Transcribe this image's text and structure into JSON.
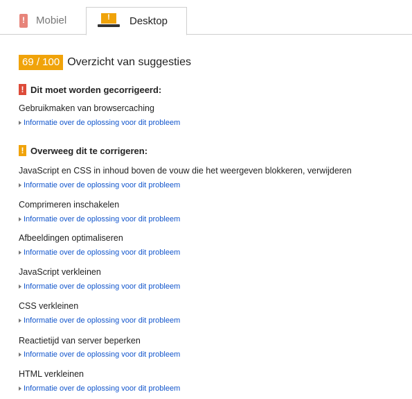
{
  "tabs": {
    "mobile": "Mobiel",
    "desktop": "Desktop"
  },
  "score": {
    "value": "69 / 100",
    "title": "Overzicht van suggesties"
  },
  "must_fix": {
    "heading": "Dit moet worden gecorrigeerd:",
    "items": [
      {
        "label": "Gebruikmaken van browsercaching",
        "link": "Informatie over de oplossing voor dit probleem"
      }
    ]
  },
  "consider_fix": {
    "heading": "Overweeg dit te corrigeren:",
    "items": [
      {
        "label": "JavaScript en CSS in inhoud boven de vouw die het weergeven blokkeren, verwijderen",
        "link": "Informatie over de oplossing voor dit probleem"
      },
      {
        "label": "Comprimeren inschakelen",
        "link": "Informatie over de oplossing voor dit probleem"
      },
      {
        "label": "Afbeeldingen optimaliseren",
        "link": "Informatie over de oplossing voor dit probleem"
      },
      {
        "label": "JavaScript verkleinen",
        "link": "Informatie over de oplossing voor dit probleem"
      },
      {
        "label": "CSS verkleinen",
        "link": "Informatie over de oplossing voor dit probleem"
      },
      {
        "label": "Reactietijd van server beperken",
        "link": "Informatie over de oplossing voor dit probleem"
      },
      {
        "label": "HTML verkleinen",
        "link": "Informatie over de oplossing voor dit probleem"
      }
    ]
  },
  "colors": {
    "score_badge": "#f0a30a",
    "warning_red": "#dd4b39",
    "warning_orange": "#f0a30a",
    "link": "#1155cc"
  }
}
